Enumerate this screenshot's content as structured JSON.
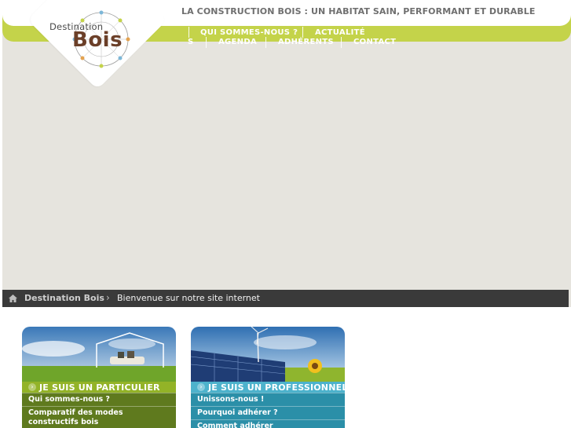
{
  "header": {
    "tagline": "LA CONSTRUCTION BOIS : UN HABITAT SAIN, PERFORMANT ET DURABLE",
    "logo_line1": "Destination",
    "logo_line2": "Bois",
    "nav": [
      {
        "label": "QUI SOMMES-NOUS ?"
      },
      {
        "label": "ACTUALITÉ"
      },
      {
        "label": "S"
      },
      {
        "label": "AGENDA"
      },
      {
        "label": "ADHÉRENTS"
      },
      {
        "label": "CONTACT"
      }
    ]
  },
  "breadcrumb": {
    "home": "Destination Bois",
    "current": "Bienvenue sur notre site internet"
  },
  "cards": [
    {
      "title": "JE SUIS UN PARTICULIER",
      "links": [
        "Qui sommes-nous ?",
        "Comparatif des modes constructifs bois"
      ]
    },
    {
      "title": "JE SUIS UN PROFESSIONNEL",
      "links": [
        "Unissons-nous !",
        "Pourquoi adhérer ?",
        "Comment adhérer"
      ]
    }
  ],
  "colors": {
    "lime": "#c4d34a",
    "brown": "#6b3f28",
    "green": "#5f7a1e",
    "blue": "#2b8fa8",
    "dark": "#3a3a3a"
  }
}
